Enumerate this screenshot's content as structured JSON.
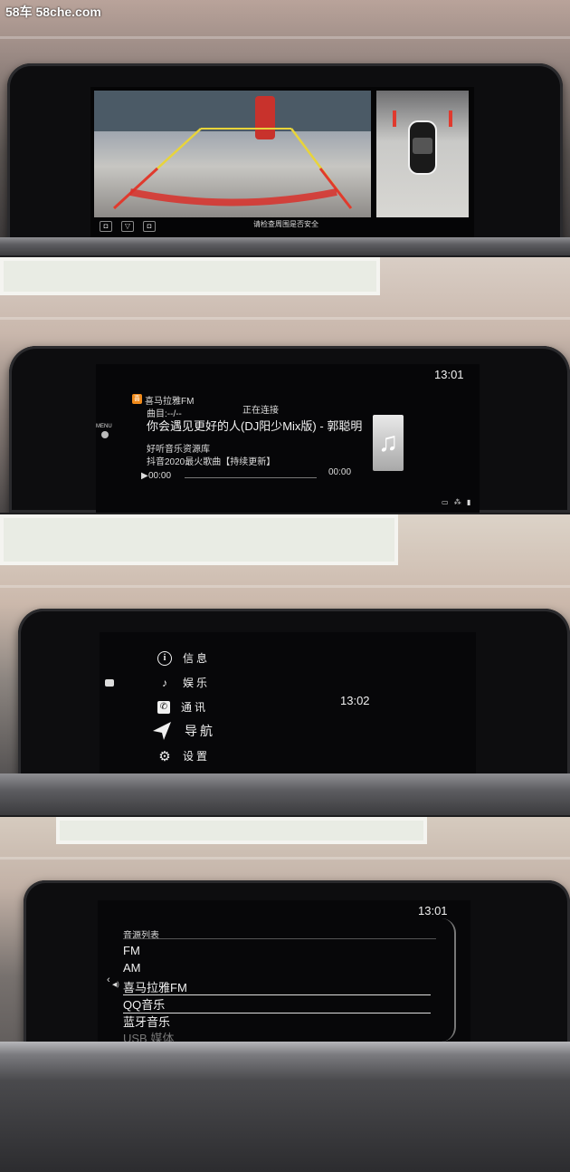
{
  "watermark": "58车 58che.com",
  "camera_view": {
    "warning_text": "请检查周围是否安全"
  },
  "now_playing": {
    "clock": "13:01",
    "source_name": "喜马拉雅FM",
    "track_label": "曲目:--/--",
    "connection_status": "正在连接",
    "song_title": "你会遇见更好的人(DJ阳少Mix版) - 郭聪明",
    "album_line1": "好听音乐资源库",
    "album_line2": "抖音2020最火歌曲【持续更新】",
    "elapsed": "00:00",
    "duration": "00:00",
    "menu_label": "MENU",
    "progress": 0
  },
  "home_menu": {
    "clock": "13:02",
    "items": [
      {
        "label": "信息",
        "icon": "info-icon"
      },
      {
        "label": "娱乐",
        "icon": "music-note-icon"
      },
      {
        "label": "通讯",
        "icon": "phone-icon"
      },
      {
        "label": "导航",
        "icon": "navigation-arrow-icon"
      },
      {
        "label": "设置",
        "icon": "gear-icon"
      }
    ],
    "active_index": 3
  },
  "source_list": {
    "clock": "13:01",
    "title": "音源列表",
    "items": [
      "FM",
      "AM",
      "喜马拉雅FM",
      "QQ音乐",
      "蓝牙音乐",
      "USB 媒体"
    ],
    "playing_index": 2,
    "selected_index": 3
  }
}
